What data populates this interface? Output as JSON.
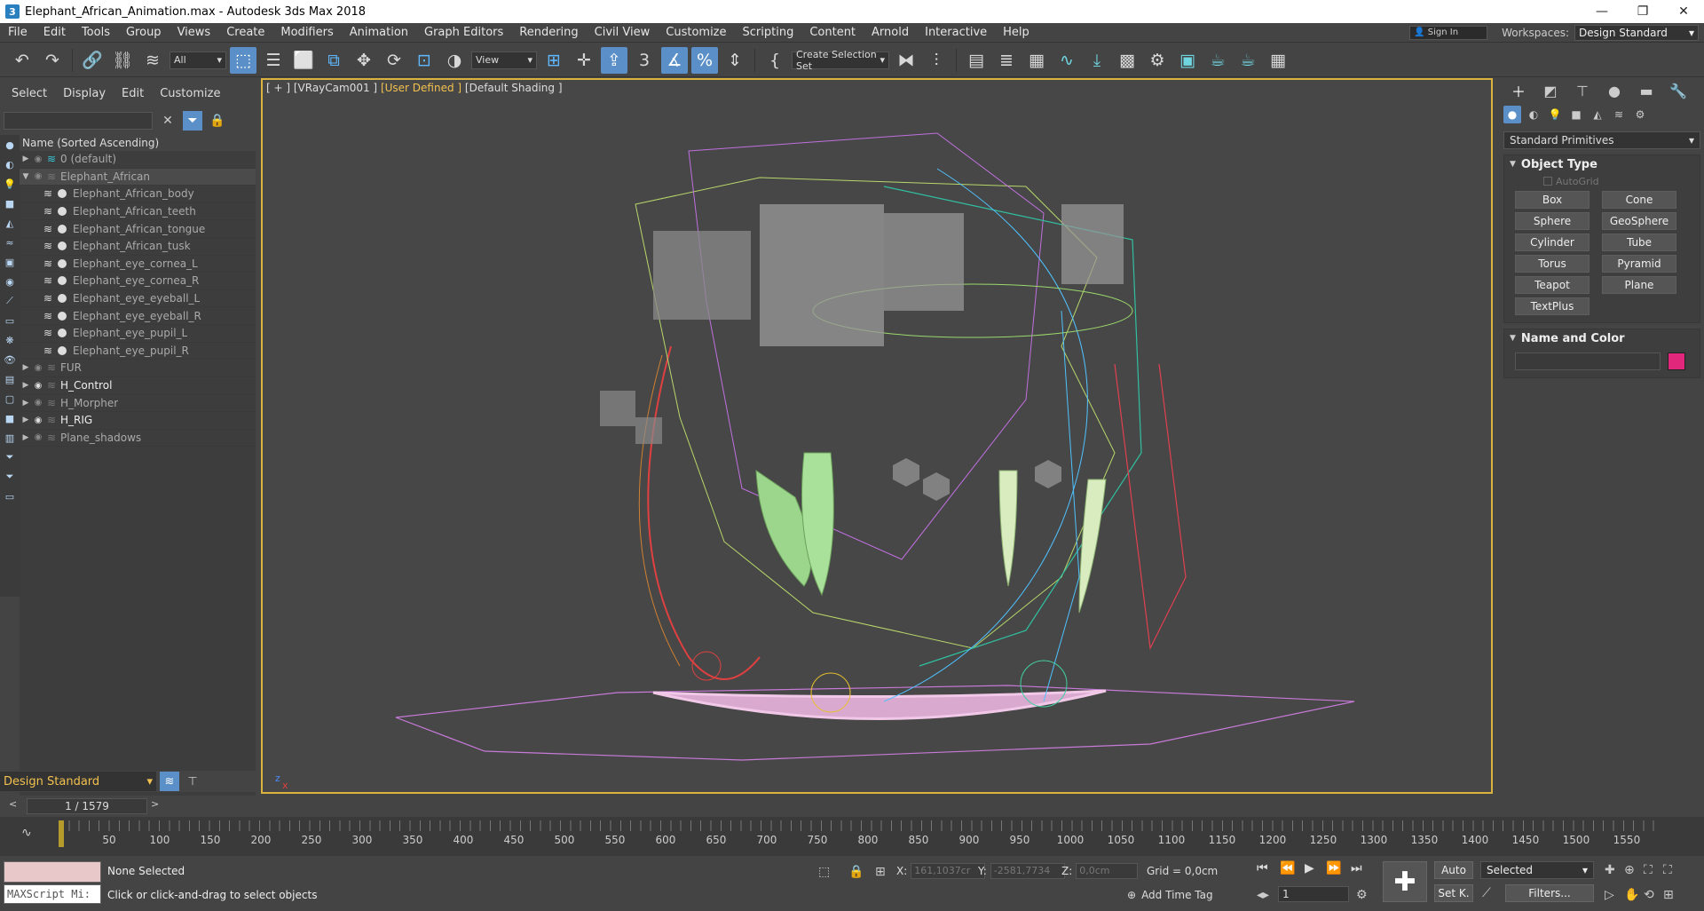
{
  "window": {
    "title": "Elephant_African_Animation.max - Autodesk 3ds Max 2018",
    "app_icon": "3",
    "minimize": "—",
    "maximize": "❐",
    "close": "✕"
  },
  "menubar": {
    "items": [
      "File",
      "Edit",
      "Tools",
      "Group",
      "Views",
      "Create",
      "Modifiers",
      "Animation",
      "Graph Editors",
      "Rendering",
      "Civil View",
      "Customize",
      "Scripting",
      "Content",
      "Arnold",
      "Interactive",
      "Help"
    ],
    "sign_in": "Sign In",
    "workspaces_label": "Workspaces:",
    "workspace_value": "Design Standard"
  },
  "toolbar": {
    "filter_value": "All",
    "view_value": "View",
    "selection_set": "Create Selection Set"
  },
  "scene_explorer": {
    "tabs": [
      "Select",
      "Display",
      "Edit",
      "Customize"
    ],
    "column_header": "Name (Sorted Ascending)",
    "rows": [
      {
        "label": "0 (default)",
        "level": 0,
        "expand": "▶",
        "kind": "layer-cyan"
      },
      {
        "label": "Elephant_African",
        "level": 0,
        "expand": "▼",
        "kind": "layer",
        "selected": true
      },
      {
        "label": "Elephant_African_body",
        "level": 1,
        "kind": "object"
      },
      {
        "label": "Elephant_African_teeth",
        "level": 1,
        "kind": "object"
      },
      {
        "label": "Elephant_African_tongue",
        "level": 1,
        "kind": "object"
      },
      {
        "label": "Elephant_African_tusk",
        "level": 1,
        "kind": "object"
      },
      {
        "label": "Elephant_eye_cornea_L",
        "level": 1,
        "kind": "object"
      },
      {
        "label": "Elephant_eye_cornea_R",
        "level": 1,
        "kind": "object"
      },
      {
        "label": "Elephant_eye_eyeball_L",
        "level": 1,
        "kind": "object"
      },
      {
        "label": "Elephant_eye_eyeball_R",
        "level": 1,
        "kind": "object"
      },
      {
        "label": "Elephant_eye_pupil_L",
        "level": 1,
        "kind": "object"
      },
      {
        "label": "Elephant_eye_pupil_R",
        "level": 1,
        "kind": "object"
      },
      {
        "label": "FUR",
        "level": 0,
        "expand": "▶",
        "kind": "layer"
      },
      {
        "label": "H_Control",
        "level": 0,
        "expand": "▶",
        "kind": "layer",
        "visible": true
      },
      {
        "label": "H_Morpher",
        "level": 0,
        "expand": "▶",
        "kind": "layer"
      },
      {
        "label": "H_RIG",
        "level": 0,
        "expand": "▶",
        "kind": "layer",
        "visible": true
      },
      {
        "label": "Plane_shadows",
        "level": 0,
        "expand": "▶",
        "kind": "layer"
      }
    ],
    "workspace": "Design Standard"
  },
  "viewport": {
    "label_prefix": "[ + ] [VRayCam001 ]",
    "label_mode": "[User Defined ]",
    "label_shading": "[Default Shading ]"
  },
  "command_panel": {
    "category": "Standard Primitives",
    "object_type_title": "Object Type",
    "autogrid": "AutoGrid",
    "buttons": [
      "Box",
      "Cone",
      "Sphere",
      "GeoSphere",
      "Cylinder",
      "Tube",
      "Torus",
      "Pyramid",
      "Teapot",
      "Plane",
      "TextPlus"
    ],
    "name_color_title": "Name and Color",
    "color": "#e0277c"
  },
  "timeline": {
    "frame_display": "1 / 1579",
    "prev": "<",
    "next": ">",
    "tick_labels": [
      "50",
      "100",
      "150",
      "200",
      "250",
      "300",
      "350",
      "400",
      "450",
      "500",
      "550",
      "600",
      "650",
      "700",
      "750",
      "800",
      "850",
      "900",
      "950",
      "1000",
      "1050",
      "1100",
      "1150",
      "1200",
      "1250",
      "1300",
      "1350",
      "1400",
      "1450",
      "1500",
      "1550"
    ]
  },
  "status": {
    "maxscript": "MAXScript Mi:",
    "selection": "None Selected",
    "prompt": "Click or click-and-drag to select objects",
    "x_label": "X:",
    "x_value": "161,1037cr",
    "y_label": "Y:",
    "y_value": "-2581,7734",
    "z_label": "Z:",
    "z_value": "0,0cm",
    "grid": "Grid = 0,0cm",
    "add_time_tag": "Add Time Tag",
    "auto": "Auto",
    "selected_dd": "Selected",
    "set_key": "Set K.",
    "filters": "Filters...",
    "current_frame": "1"
  }
}
